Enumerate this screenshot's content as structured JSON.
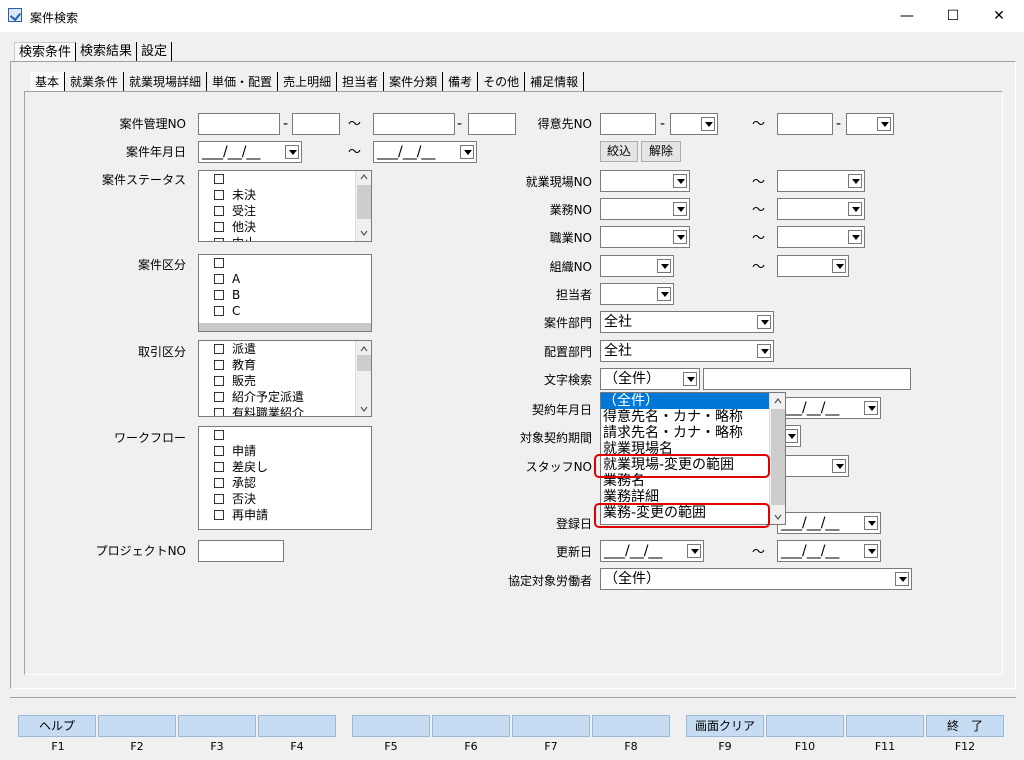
{
  "window": {
    "title": "案件検索",
    "minimize": "—",
    "maximize": "☐",
    "close": "✕"
  },
  "top_tabs": [
    "検索条件",
    "検索結果",
    "設定"
  ],
  "sub_tabs": [
    "基本",
    "就業条件",
    "就業現場詳細",
    "単価・配置",
    "売上明細",
    "担当者",
    "案件分類",
    "備考",
    "その他",
    "補足情報"
  ],
  "left": {
    "case_no_label": "案件管理NO",
    "case_date_label": "案件年月日",
    "case_date_value": "___/__/__",
    "case_date_to_value": "___/__/__",
    "tilde": "～",
    "dash": "-",
    "status_label": "案件ステータス",
    "status_items": [
      "",
      "未決",
      "受注",
      "他決",
      "中止"
    ],
    "kubun_label": "案件区分",
    "kubun_items": [
      "",
      "A",
      "B",
      "C"
    ],
    "torihiki_label": "取引区分",
    "torihiki_items": [
      "派遣",
      "教育",
      "販売",
      "紹介予定派遣",
      "有料職業紹介"
    ],
    "workflow_label": "ワークフロー",
    "workflow_items": [
      "",
      "申請",
      "差戻し",
      "承認",
      "否決",
      "再申請"
    ],
    "project_label": "プロジェクトNO"
  },
  "right": {
    "tokui_label": "得意先NO",
    "narrow_button": "絞込",
    "clear_button": "解除",
    "site_label": "就業現場NO",
    "gyomu_label": "業務NO",
    "shokugyo_label": "職業NO",
    "soshiki_label": "組織NO",
    "tanto_label": "担当者",
    "case_dept_label": "案件部門",
    "case_dept_value": "全社",
    "haichi_dept_label": "配置部門",
    "haichi_dept_value": "全社",
    "text_search_label": "文字検索",
    "text_search_value": "（全件）",
    "contract_date_label": "契約年月日",
    "contract_period_label": "対象契約期間",
    "staff_label": "スタッフNO",
    "register_label": "登録日",
    "update_label": "更新日",
    "date_value": "___/__/__",
    "kyotei_label": "協定対象労働者",
    "kyotei_value": "（全件）",
    "tilde": "～"
  },
  "dropdown_options": [
    "（全件）",
    "得意先名・カナ・略称",
    "請求先名・カナ・略称",
    "就業現場名",
    "就業現場-変更の範囲",
    "業務名",
    "業務詳細",
    "業務-変更の範囲"
  ],
  "highlight_color": "#e00000",
  "fkeys": [
    {
      "label": "ヘルプ",
      "key": "F1"
    },
    {
      "label": "",
      "key": "F2"
    },
    {
      "label": "",
      "key": "F3"
    },
    {
      "label": "",
      "key": "F4"
    },
    {
      "label": "",
      "key": "F5"
    },
    {
      "label": "",
      "key": "F6"
    },
    {
      "label": "",
      "key": "F7"
    },
    {
      "label": "",
      "key": "F8"
    },
    {
      "label": "画面クリア",
      "key": "F9"
    },
    {
      "label": "",
      "key": "F10"
    },
    {
      "label": "",
      "key": "F11"
    },
    {
      "label": "終　了",
      "key": "F12"
    }
  ]
}
